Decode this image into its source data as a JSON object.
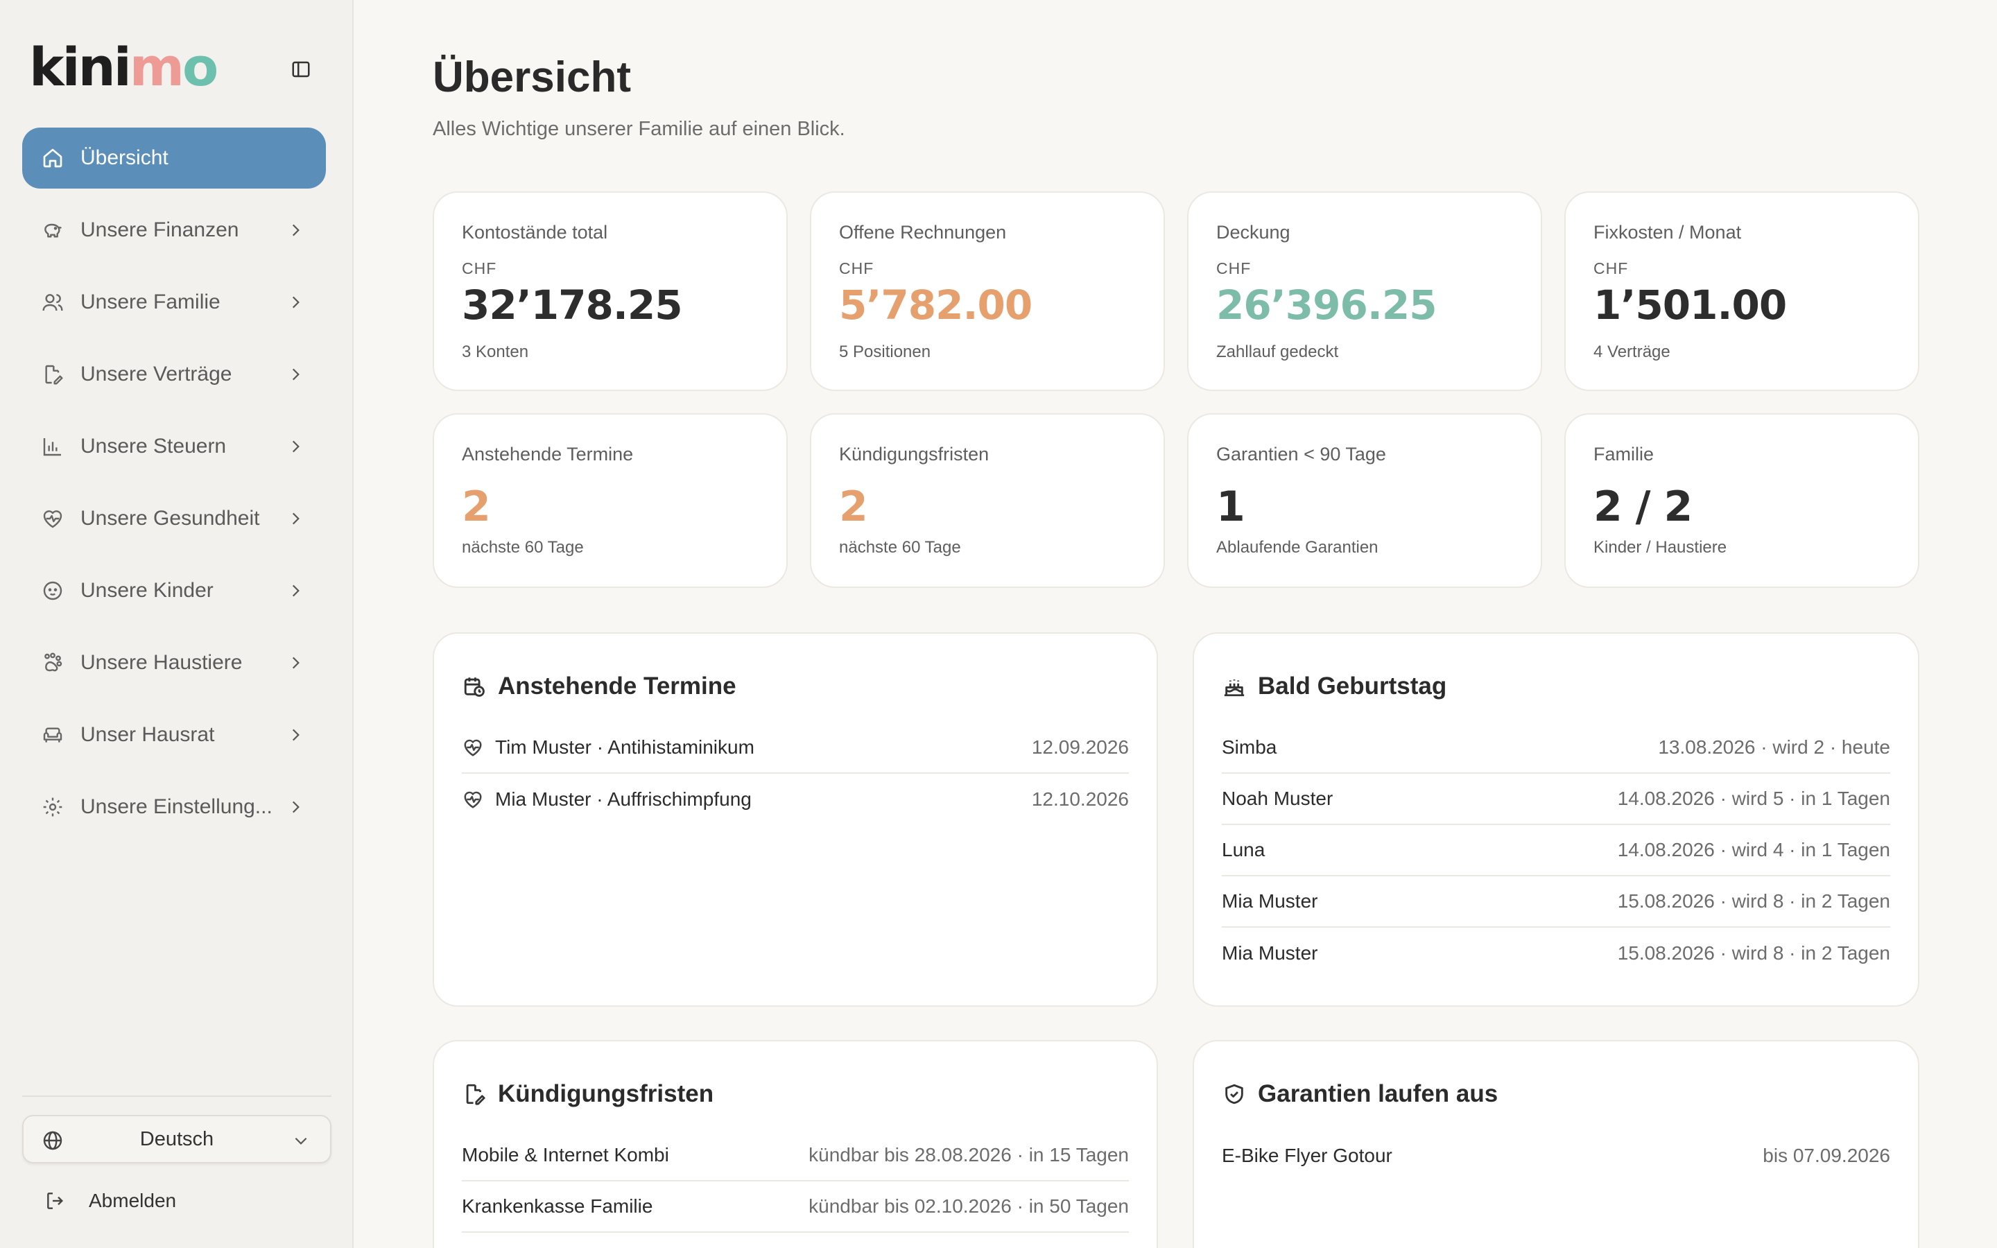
{
  "brand": {
    "logo_part1": "kini",
    "logo_part2": "m",
    "logo_part3": "o"
  },
  "sidebar": {
    "items": [
      {
        "label": "Übersicht",
        "icon": "home-icon",
        "active": true
      },
      {
        "label": "Unsere Finanzen",
        "icon": "piggy-bank-icon"
      },
      {
        "label": "Unsere Familie",
        "icon": "users-icon"
      },
      {
        "label": "Unsere Verträge",
        "icon": "file-edit-icon"
      },
      {
        "label": "Unsere Steuern",
        "icon": "bar-chart-icon"
      },
      {
        "label": "Unsere Gesundheit",
        "icon": "heart-pulse-icon"
      },
      {
        "label": "Unsere Kinder",
        "icon": "baby-icon"
      },
      {
        "label": "Unsere Haustiere",
        "icon": "paw-icon"
      },
      {
        "label": "Unser Hausrat",
        "icon": "sofa-icon"
      },
      {
        "label": "Unsere Einstellung...",
        "icon": "gear-icon"
      }
    ],
    "language": "Deutsch",
    "logout": "Abmelden"
  },
  "header": {
    "title": "Übersicht",
    "subtitle": "Alles Wichtige unserer Familie auf einen Blick."
  },
  "stats": {
    "kontostaende": {
      "label": "Kontostände total",
      "currency": "CHF",
      "value": "32’178.25",
      "sub": "3 Konten"
    },
    "rechnungen": {
      "label": "Offene Rechnungen",
      "currency": "CHF",
      "value": "5’782.00",
      "sub": "5 Positionen"
    },
    "deckung": {
      "label": "Deckung",
      "currency": "CHF",
      "value": "26’396.25",
      "sub": "Zahllauf gedeckt"
    },
    "fixkosten": {
      "label": "Fixkosten / Monat",
      "currency": "CHF",
      "value": "1’501.00",
      "sub": "4 Verträge"
    },
    "termine": {
      "label": "Anstehende Termine",
      "value": "2",
      "sub": "nächste 60 Tage"
    },
    "kuendigung": {
      "label": "Kündigungsfristen",
      "value": "2",
      "sub": "nächste 60 Tage"
    },
    "garantien": {
      "label": "Garantien < 90 Tage",
      "value": "1",
      "sub": "Ablaufende Garantien"
    },
    "familie": {
      "label": "Familie",
      "value": "2 / 2",
      "sub": "Kinder / Haustiere"
    }
  },
  "panels": {
    "termine": {
      "title": "Anstehende Termine",
      "rows": [
        {
          "name": "Tim Muster · Antihistaminikum",
          "meta": "12.09.2026"
        },
        {
          "name": "Mia Muster · Auffrischimpfung",
          "meta": "12.10.2026"
        }
      ]
    },
    "geburtstag": {
      "title": "Bald Geburtstag",
      "rows": [
        {
          "name": "Simba",
          "meta": "13.08.2026 · wird 2 · heute"
        },
        {
          "name": "Noah Muster",
          "meta": "14.08.2026 · wird 5 · in 1 Tagen"
        },
        {
          "name": "Luna",
          "meta": "14.08.2026 · wird 4 · in 1 Tagen"
        },
        {
          "name": "Mia Muster",
          "meta": "15.08.2026 · wird 8 · in 2 Tagen"
        },
        {
          "name": "Mia Muster",
          "meta": "15.08.2026 · wird 8 · in 2 Tagen"
        }
      ]
    },
    "kuendigung": {
      "title": "Kündigungsfristen",
      "rows": [
        {
          "name": "Mobile & Internet Kombi",
          "meta": "kündbar bis 28.08.2026 · in 15 Tagen"
        },
        {
          "name": "Krankenkasse Familie",
          "meta": "kündbar bis 02.10.2026 · in 50 Tagen"
        }
      ]
    },
    "garantien": {
      "title": "Garantien laufen aus",
      "rows": [
        {
          "name": "E-Bike Flyer Gotour",
          "meta": "bis 07.09.2026"
        }
      ]
    }
  },
  "colors": {
    "accent": "#5b8fba",
    "orange": "#e5a06d",
    "green": "#7cbca8"
  }
}
